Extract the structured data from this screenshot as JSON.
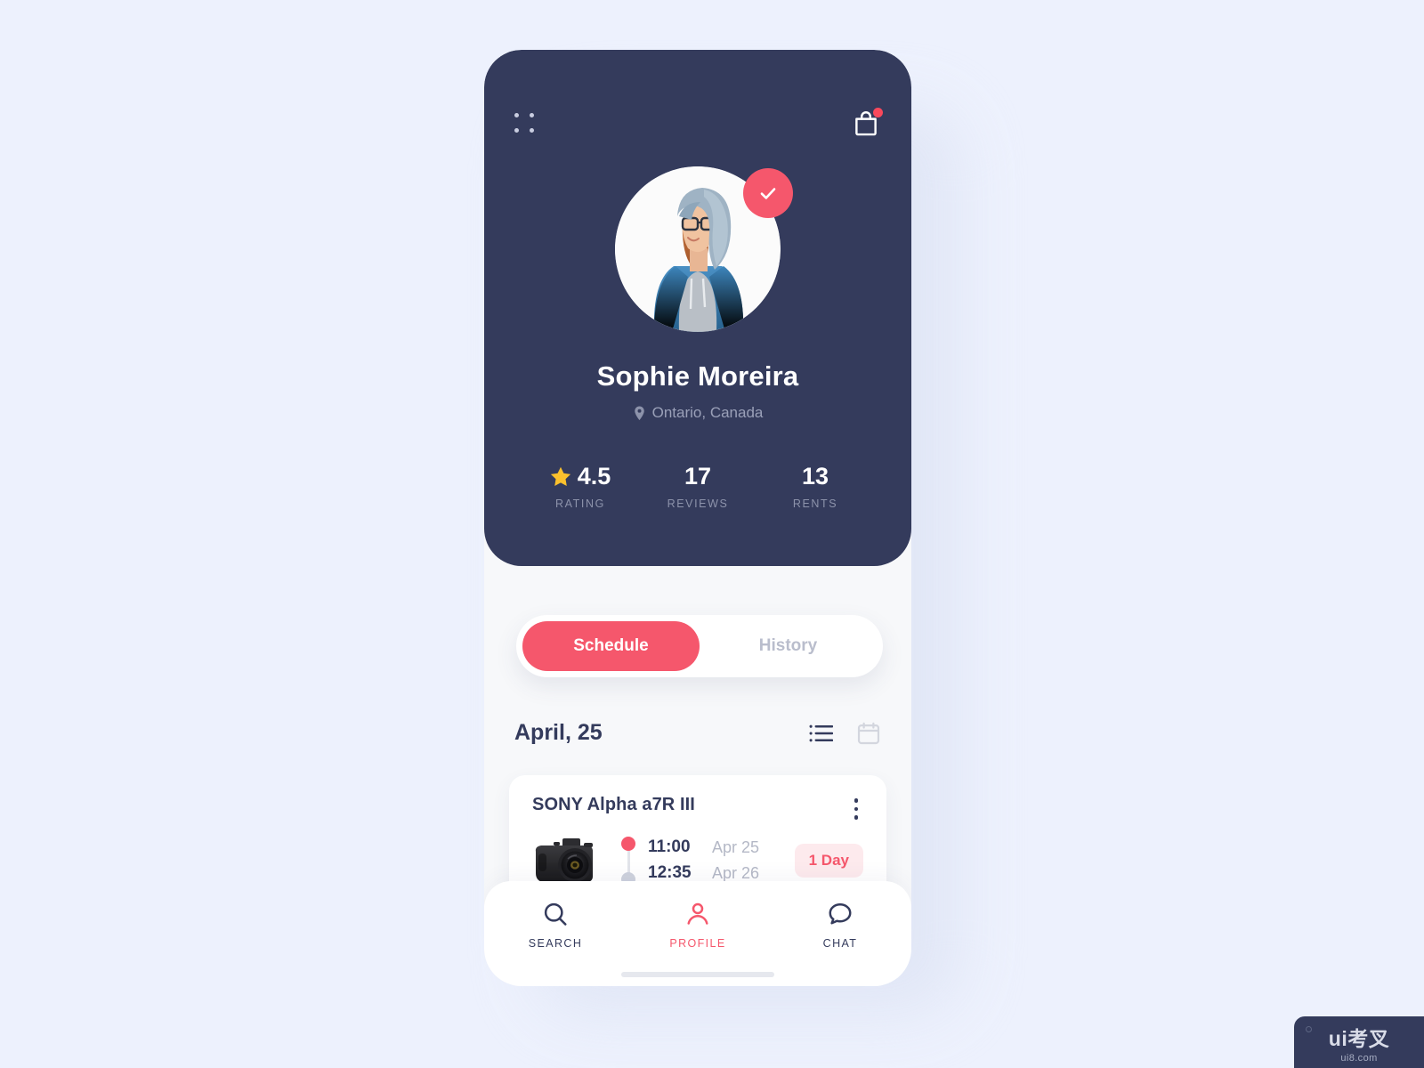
{
  "theme": {
    "page_bg": "#edf1fd",
    "header_bg": "#343b5c",
    "accent": "#f5576c",
    "body_bg": "#f7f8fa",
    "card_bg": "#ffffff",
    "muted": "#9aa0b8",
    "star": "#fbc02d"
  },
  "header": {
    "menu_icon": "grid-dots-icon",
    "bag_icon": "shopping-bag-icon",
    "bag_badge": "",
    "verified_icon": "check-icon",
    "avatar_alt": "user-avatar",
    "name": "Sophie Moreira",
    "location_icon": "map-pin-icon",
    "location": "Ontario, Canada",
    "stats": [
      {
        "value": "4.5",
        "label": "RATING",
        "icon": "star-icon"
      },
      {
        "value": "17",
        "label": "REVIEWS",
        "icon": ""
      },
      {
        "value": "13",
        "label": "RENTS",
        "icon": ""
      }
    ]
  },
  "tabs": {
    "items": [
      {
        "label": "Schedule",
        "active": true
      },
      {
        "label": "History",
        "active": false
      }
    ]
  },
  "schedule": {
    "date_title": "April, 25",
    "view_toggle": [
      {
        "icon": "list-view-icon",
        "active": true
      },
      {
        "icon": "calendar-view-icon",
        "active": false
      }
    ],
    "items": [
      {
        "title": "SONY Alpha a7R III",
        "thumb": "camera-image",
        "menu_icon": "kebab-menu-icon",
        "start_time": "11:00",
        "start_date": "Apr 25",
        "end_time": "12:35",
        "end_date": "Apr 26",
        "duration_badge": "1 Day"
      }
    ]
  },
  "bottom_nav": {
    "items": [
      {
        "label": "SEARCH",
        "icon": "search-icon",
        "active": false
      },
      {
        "label": "PROFILE",
        "icon": "person-icon",
        "active": true
      },
      {
        "label": "CHAT",
        "icon": "chat-bubble-icon",
        "active": false
      }
    ]
  },
  "watermark": {
    "main": "ui考叉",
    "sub": "ui8.com"
  }
}
